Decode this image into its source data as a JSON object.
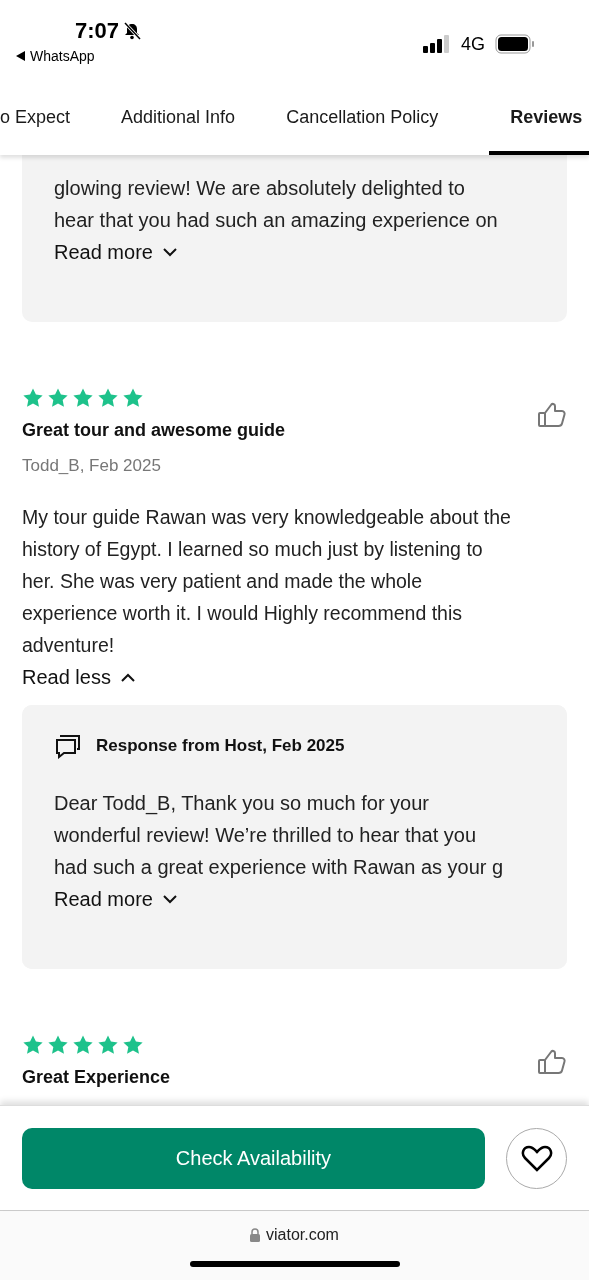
{
  "status_bar": {
    "time": "7:07",
    "back_app": "WhatsApp",
    "network": "4G"
  },
  "tabs": [
    {
      "label": "o Expect",
      "selected": false
    },
    {
      "label": "Additional Info",
      "selected": false
    },
    {
      "label": "Cancellation Policy",
      "selected": false
    },
    {
      "label": "Reviews",
      "selected": true
    }
  ],
  "reviews": [
    {
      "kind": "response_tail",
      "response": {
        "body_lines": [
          "glowing review! We are absolutely delighted to",
          "hear that you had such an amazing experience on"
        ],
        "toggle": "Read more",
        "expanded": false
      }
    },
    {
      "kind": "review",
      "stars": 5,
      "title": "Great tour and awesome guide",
      "author": "Todd_B, Feb 2025",
      "body_lines": [
        "My tour guide Rawan was very knowledgeable about the",
        "history of Egypt. I learned so much just by listening to",
        "her. She was very patient and made the whole",
        "experience worth it. I would Highly recommend this",
        "adventure!"
      ],
      "toggle": "Read less",
      "expanded": true,
      "response": {
        "header": "Response from Host, Feb 2025",
        "body_lines": [
          "Dear Todd_B, Thank you so much for your",
          "wonderful review! We’re thrilled to hear that you",
          "had such a great experience with Rawan as your g"
        ],
        "toggle": "Read more",
        "expanded": false
      }
    },
    {
      "kind": "review",
      "stars": 5,
      "title": "Great Experience"
    }
  ],
  "action_bar": {
    "button": "Check Availability"
  },
  "browser": {
    "url": "viator.com"
  }
}
